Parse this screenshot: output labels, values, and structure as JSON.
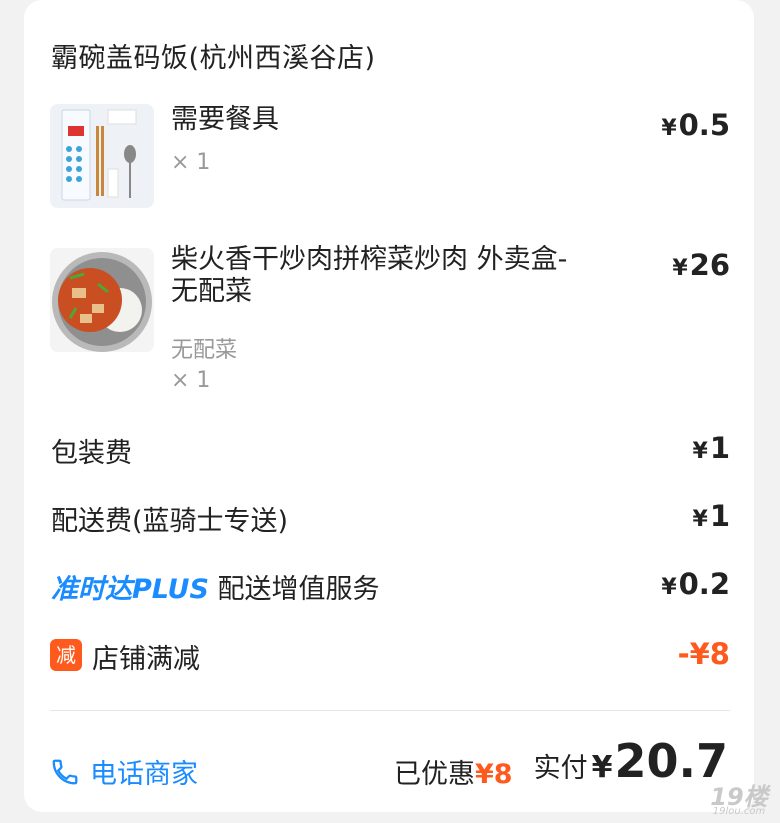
{
  "shop": {
    "name": "霸碗盖码饭(杭州西溪谷店)"
  },
  "items": [
    {
      "name": "需要餐具",
      "option": "",
      "quantity": "× 1",
      "price": "0.5",
      "image_icon": "cutlery-pack-icon"
    },
    {
      "name": "柴火香干炒肉拼榨菜炒肉 外卖盒-无配菜",
      "option": "无配菜",
      "quantity": "× 1",
      "price": "26",
      "image_icon": "food-bowl-icon"
    }
  ],
  "currency": "¥",
  "fees": {
    "packaging": {
      "label": "包装费",
      "value": "1"
    },
    "delivery": {
      "label": "配送费(蓝骑士专送)",
      "value": "1"
    },
    "plus": {
      "brand": "准时达PLUS",
      "label": "配送增值服务",
      "value": "0.2"
    },
    "discount": {
      "badge": "减",
      "label": "店铺满减",
      "value": "-¥8"
    }
  },
  "footer": {
    "call_label": "电话商家",
    "saved_label": "已优惠",
    "saved_amount": "¥8",
    "paid_label": "实付",
    "paid_amount": "20.7"
  },
  "watermark": {
    "main": "19楼",
    "sub": "19lou.com"
  },
  "colors": {
    "accent": "#1a8cff",
    "discount": "#ff5a1e",
    "text": "#222222",
    "muted": "#999999"
  }
}
